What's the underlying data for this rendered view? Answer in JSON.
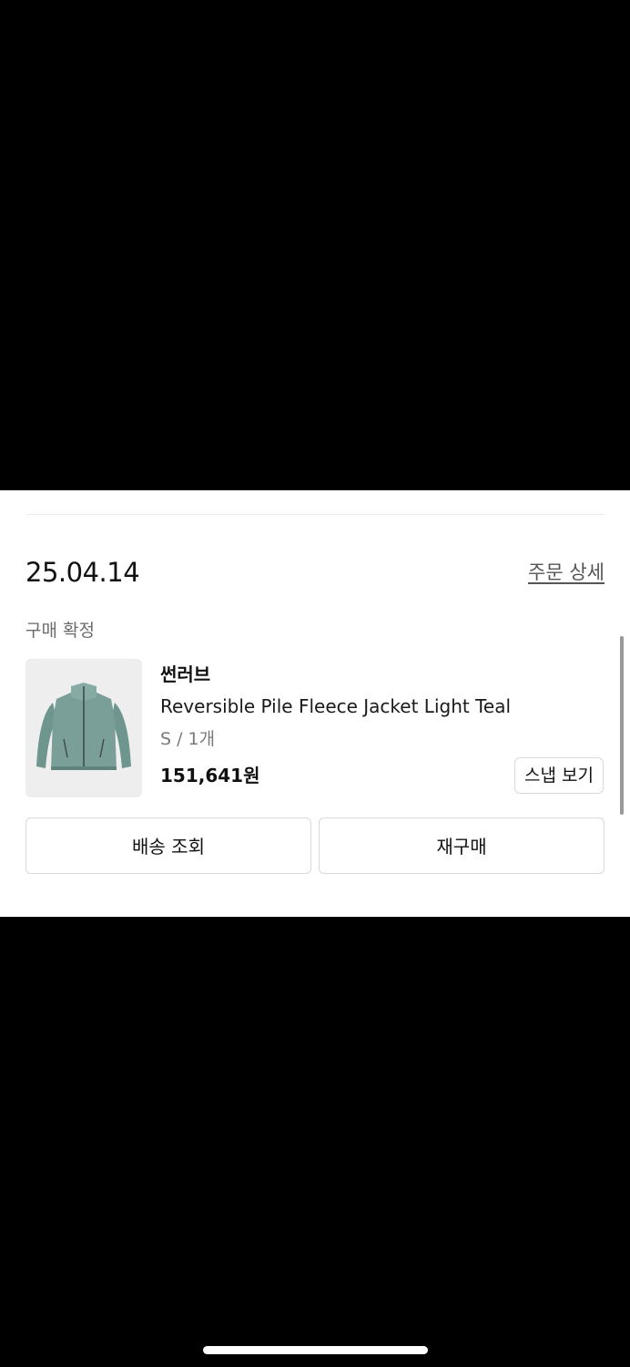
{
  "order": {
    "date": "25.04.14",
    "detail_link": "주문 상세",
    "status": "구매 확정"
  },
  "product": {
    "brand": "썬러브",
    "name": "Reversible Pile Fleece Jacket Light Teal",
    "option": "S / 1개",
    "price": "151,641원",
    "image_icon": "jacket-image",
    "image_color": "#7a9e98"
  },
  "buttons": {
    "snap": "스냅 보기",
    "delivery": "배송 조회",
    "reorder": "재구매"
  },
  "colors": {
    "background": "#000000",
    "card": "#ffffff",
    "border": "#d9d9d9",
    "muted_text": "#7a7a7a"
  }
}
